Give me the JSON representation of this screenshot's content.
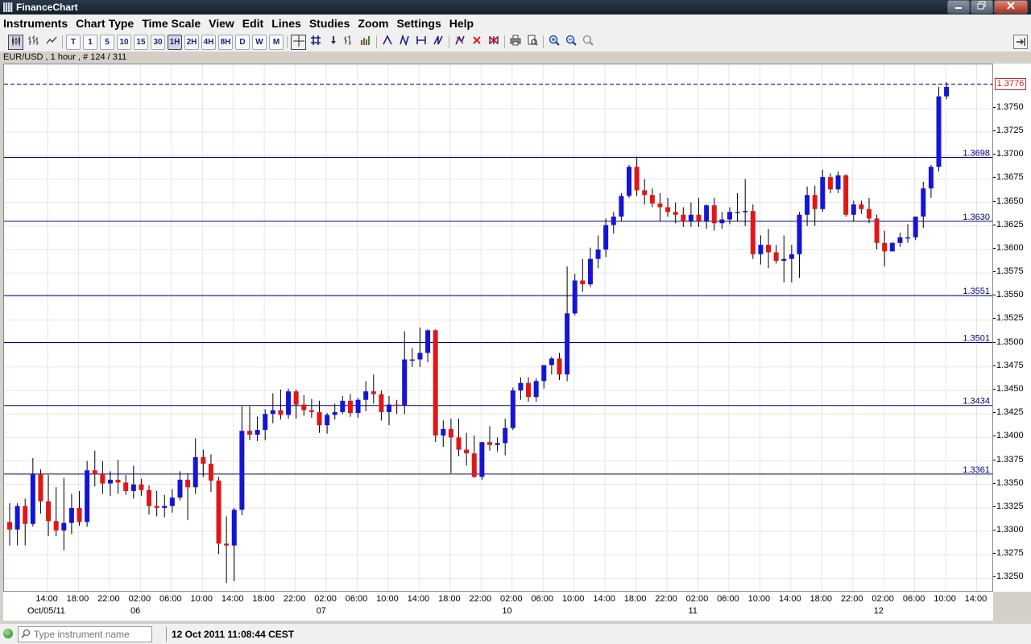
{
  "window": {
    "title": "FinanceChart",
    "buttons": [
      "minimize",
      "maximize",
      "close"
    ]
  },
  "menu": [
    "Instruments",
    "Chart Type",
    "Time Scale",
    "View",
    "Edit",
    "Lines",
    "Studies",
    "Zoom",
    "Settings",
    "Help"
  ],
  "toolbar": {
    "chart_type_icons": [
      "candlestick-icon",
      "bar-chart-icon",
      "line-chart-icon"
    ],
    "timescale": [
      "T",
      "1",
      "5",
      "10",
      "15",
      "30",
      "1H",
      "2H",
      "4H",
      "8H",
      "D",
      "W",
      "M"
    ],
    "active_timescale": "1H",
    "tools": [
      "crosshair-icon",
      "grid-icon",
      "arrow-down-icon",
      "ohlc-icon",
      "volume-icon",
      "draw-line-icon-1",
      "draw-line-icon-2",
      "draw-line-icon-3",
      "draw-line-icon-4",
      "pencil-icon",
      "delete-icon",
      "delete-all-icon",
      "print-icon",
      "print-preview-icon",
      "zoom-in-icon",
      "zoom-out-icon",
      "zoom-fit-icon"
    ]
  },
  "symbol_info": "EUR/USD , 1 hour , # 124 / 311",
  "colors": {
    "up": "#1515d6",
    "down": "#e11717",
    "level_line": "#000080",
    "last_price": "#c62828",
    "grid": "#e6e6e6"
  },
  "status": {
    "search_placeholder": "Type instrument name",
    "datetime": "12 Oct 2011 11:08:44 CEST"
  },
  "chart_data": {
    "type": "candlestick",
    "instrument": "EUR/USD",
    "interval": "1 hour",
    "ylim": [
      1.3235,
      1.3797
    ],
    "y_ticks": [
      "1.3250",
      "1.3275",
      "1.3300",
      "1.3325",
      "1.3350",
      "1.3375",
      "1.3400",
      "1.3425",
      "1.3450",
      "1.3475",
      "1.3500",
      "1.3525",
      "1.3550",
      "1.3575",
      "1.3600",
      "1.3625",
      "1.3650",
      "1.3675",
      "1.3700",
      "1.3725",
      "1.3750"
    ],
    "last_price": "1.3776",
    "levels": [
      "1.3698",
      "1.3630",
      "1.3551",
      "1.3501",
      "1.3434",
      "1.3361"
    ],
    "x_time_labels": [
      "14:00",
      "18:00",
      "22:00",
      "02:00",
      "06:00",
      "10:00",
      "14:00",
      "18:00",
      "22:00",
      "02:00",
      "06:00",
      "10:00",
      "14:00",
      "18:00",
      "22:00",
      "02:00",
      "06:00",
      "10:00",
      "14:00",
      "18:00",
      "22:00",
      "02:00",
      "06:00",
      "10:00",
      "14:00",
      "18:00",
      "22:00",
      "02:00",
      "06:00",
      "10:00",
      "14:00"
    ],
    "x_date_labels": [
      {
        "label": "Oct/05/11",
        "after_tick": 0
      },
      {
        "label": "06",
        "after_tick": 3
      },
      {
        "label": "07",
        "after_tick": 9
      },
      {
        "label": "10",
        "after_tick": 15
      },
      {
        "label": "11",
        "after_tick": 21
      },
      {
        "label": "12",
        "after_tick": 27
      }
    ],
    "candles": [
      [
        1.331,
        1.333,
        1.3285,
        1.3302
      ],
      [
        1.3302,
        1.333,
        1.3285,
        1.3327
      ],
      [
        1.3327,
        1.3335,
        1.3285,
        1.3308
      ],
      [
        1.3308,
        1.3378,
        1.3305,
        1.3361
      ],
      [
        1.3361,
        1.3366,
        1.3319,
        1.3332
      ],
      [
        1.3332,
        1.336,
        1.3295,
        1.3311
      ],
      [
        1.3311,
        1.3347,
        1.3295,
        1.3301
      ],
      [
        1.3301,
        1.3357,
        1.328,
        1.3309
      ],
      [
        1.3309,
        1.334,
        1.3297,
        1.3325
      ],
      [
        1.3325,
        1.3343,
        1.3306,
        1.331
      ],
      [
        1.331,
        1.3375,
        1.3305,
        1.3365
      ],
      [
        1.3365,
        1.3386,
        1.3348,
        1.3361
      ],
      [
        1.3361,
        1.3375,
        1.334,
        1.3351
      ],
      [
        1.3351,
        1.3364,
        1.3338,
        1.3355
      ],
      [
        1.3355,
        1.3376,
        1.334,
        1.3352
      ],
      [
        1.3352,
        1.336,
        1.3339,
        1.3343
      ],
      [
        1.3343,
        1.337,
        1.3335,
        1.335
      ],
      [
        1.335,
        1.3356,
        1.3338,
        1.3344
      ],
      [
        1.3344,
        1.3349,
        1.3318,
        1.3327
      ],
      [
        1.3327,
        1.3343,
        1.3316,
        1.3325
      ],
      [
        1.3325,
        1.3339,
        1.3315,
        1.3327
      ],
      [
        1.3327,
        1.3345,
        1.332,
        1.3336
      ],
      [
        1.3336,
        1.3364,
        1.3333,
        1.3355
      ],
      [
        1.3355,
        1.3362,
        1.3312,
        1.3347
      ],
      [
        1.3347,
        1.3399,
        1.334,
        1.3379
      ],
      [
        1.3379,
        1.3387,
        1.3358,
        1.3372
      ],
      [
        1.3372,
        1.3382,
        1.3342,
        1.3354
      ],
      [
        1.3354,
        1.3358,
        1.3276,
        1.3287
      ],
      [
        1.3287,
        1.3316,
        1.3245,
        1.3285
      ],
      [
        1.3285,
        1.3325,
        1.3247,
        1.3323
      ],
      [
        1.3323,
        1.3433,
        1.3317,
        1.3407
      ],
      [
        1.3407,
        1.3433,
        1.3397,
        1.3403
      ],
      [
        1.3403,
        1.3422,
        1.3396,
        1.3408
      ],
      [
        1.3408,
        1.343,
        1.3397,
        1.3425
      ],
      [
        1.3425,
        1.3447,
        1.3415,
        1.3429
      ],
      [
        1.3429,
        1.3451,
        1.3419,
        1.3424
      ],
      [
        1.3424,
        1.3452,
        1.342,
        1.3449
      ],
      [
        1.3449,
        1.3451,
        1.342,
        1.3435
      ],
      [
        1.3435,
        1.3445,
        1.3423,
        1.3429
      ],
      [
        1.3429,
        1.3441,
        1.3421,
        1.3427
      ],
      [
        1.3427,
        1.3439,
        1.3405,
        1.3413
      ],
      [
        1.3413,
        1.3426,
        1.3404,
        1.3424
      ],
      [
        1.3424,
        1.3436,
        1.3419,
        1.3427
      ],
      [
        1.3427,
        1.3444,
        1.3425,
        1.3439
      ],
      [
        1.3439,
        1.3446,
        1.3422,
        1.3426
      ],
      [
        1.3426,
        1.3442,
        1.3421,
        1.344
      ],
      [
        1.344,
        1.346,
        1.3428,
        1.3449
      ],
      [
        1.3449,
        1.3467,
        1.3436,
        1.3446
      ],
      [
        1.3446,
        1.345,
        1.3418,
        1.3427
      ],
      [
        1.3427,
        1.3444,
        1.3413,
        1.3435
      ],
      [
        1.3435,
        1.344,
        1.3425,
        1.3434
      ],
      [
        1.3434,
        1.3513,
        1.3425,
        1.3483
      ],
      [
        1.3483,
        1.3495,
        1.3475,
        1.3483
      ],
      [
        1.3483,
        1.3517,
        1.3475,
        1.349
      ],
      [
        1.349,
        1.3515,
        1.348,
        1.3514
      ],
      [
        1.3514,
        1.3515,
        1.3395,
        1.3402
      ],
      [
        1.3402,
        1.3418,
        1.339,
        1.3409
      ],
      [
        1.3409,
        1.342,
        1.3362,
        1.34
      ],
      [
        1.34,
        1.342,
        1.338,
        1.3387
      ],
      [
        1.3387,
        1.3405,
        1.337,
        1.3383
      ],
      [
        1.3383,
        1.3402,
        1.3357,
        1.3358
      ],
      [
        1.3358,
        1.3395,
        1.3355,
        1.3395
      ],
      [
        1.3395,
        1.3412,
        1.3386,
        1.3392
      ],
      [
        1.3392,
        1.34,
        1.3385,
        1.3394
      ],
      [
        1.3394,
        1.342,
        1.3381,
        1.341
      ],
      [
        1.341,
        1.3453,
        1.3408,
        1.345
      ],
      [
        1.345,
        1.3464,
        1.344,
        1.3458
      ],
      [
        1.3458,
        1.3464,
        1.3438,
        1.3443
      ],
      [
        1.3443,
        1.3463,
        1.3438,
        1.346
      ],
      [
        1.346,
        1.3476,
        1.3452,
        1.3477
      ],
      [
        1.3477,
        1.3486,
        1.3467,
        1.3484
      ],
      [
        1.3484,
        1.349,
        1.3461,
        1.3467
      ],
      [
        1.3467,
        1.3582,
        1.346,
        1.3532
      ],
      [
        1.3532,
        1.3574,
        1.353,
        1.3567
      ],
      [
        1.3567,
        1.359,
        1.3555,
        1.3563
      ],
      [
        1.3563,
        1.3602,
        1.356,
        1.359
      ],
      [
        1.359,
        1.3615,
        1.358,
        1.36
      ],
      [
        1.36,
        1.3633,
        1.3592,
        1.3626
      ],
      [
        1.3626,
        1.364,
        1.3617,
        1.3635
      ],
      [
        1.3635,
        1.366,
        1.363,
        1.3657
      ],
      [
        1.3657,
        1.369,
        1.3655,
        1.3688
      ],
      [
        1.3688,
        1.3699,
        1.3657,
        1.3663
      ],
      [
        1.3663,
        1.3675,
        1.3648,
        1.3658
      ],
      [
        1.3658,
        1.3665,
        1.3645,
        1.3649
      ],
      [
        1.3649,
        1.366,
        1.363,
        1.3645
      ],
      [
        1.3645,
        1.3655,
        1.3635,
        1.364
      ],
      [
        1.364,
        1.365,
        1.3628,
        1.3637
      ],
      [
        1.3637,
        1.3645,
        1.3624,
        1.363
      ],
      [
        1.363,
        1.365,
        1.3624,
        1.3637
      ],
      [
        1.3637,
        1.3655,
        1.3624,
        1.363
      ],
      [
        1.363,
        1.3648,
        1.3622,
        1.3647
      ],
      [
        1.3647,
        1.3655,
        1.362,
        1.3628
      ],
      [
        1.3628,
        1.364,
        1.3622,
        1.3632
      ],
      [
        1.3632,
        1.3645,
        1.3627,
        1.364
      ],
      [
        1.364,
        1.366,
        1.363,
        1.364
      ],
      [
        1.364,
        1.3675,
        1.3625,
        1.3641
      ],
      [
        1.3641,
        1.3648,
        1.359,
        1.3595
      ],
      [
        1.3595,
        1.3615,
        1.3584,
        1.3605
      ],
      [
        1.3605,
        1.3622,
        1.358,
        1.3597
      ],
      [
        1.3597,
        1.3605,
        1.3585,
        1.3588
      ],
      [
        1.3588,
        1.3615,
        1.3565,
        1.359
      ],
      [
        1.359,
        1.3605,
        1.3565,
        1.3595
      ],
      [
        1.3595,
        1.364,
        1.357,
        1.3637
      ],
      [
        1.3637,
        1.3667,
        1.3625,
        1.3658
      ],
      [
        1.3658,
        1.3668,
        1.3625,
        1.3643
      ],
      [
        1.3643,
        1.3685,
        1.364,
        1.3677
      ],
      [
        1.3677,
        1.3681,
        1.366,
        1.3664
      ],
      [
        1.3664,
        1.3683,
        1.366,
        1.3679
      ],
      [
        1.3679,
        1.368,
        1.3635,
        1.3637
      ],
      [
        1.3637,
        1.3652,
        1.363,
        1.3648
      ],
      [
        1.3648,
        1.3652,
        1.3638,
        1.3643
      ],
      [
        1.3643,
        1.3655,
        1.3628,
        1.3633
      ],
      [
        1.3633,
        1.3637,
        1.36,
        1.3607
      ],
      [
        1.3607,
        1.362,
        1.3582,
        1.3598
      ],
      [
        1.3598,
        1.3608,
        1.3598,
        1.3607
      ],
      [
        1.3607,
        1.3618,
        1.3603,
        1.3613
      ],
      [
        1.3613,
        1.3627,
        1.3607,
        1.3613
      ],
      [
        1.3613,
        1.3635,
        1.361,
        1.3635
      ],
      [
        1.3635,
        1.3672,
        1.3623,
        1.3665
      ],
      [
        1.3665,
        1.369,
        1.3655,
        1.3688
      ],
      [
        1.3688,
        1.3773,
        1.3683,
        1.3763
      ],
      [
        1.3763,
        1.3778,
        1.376,
        1.3773
      ]
    ]
  }
}
